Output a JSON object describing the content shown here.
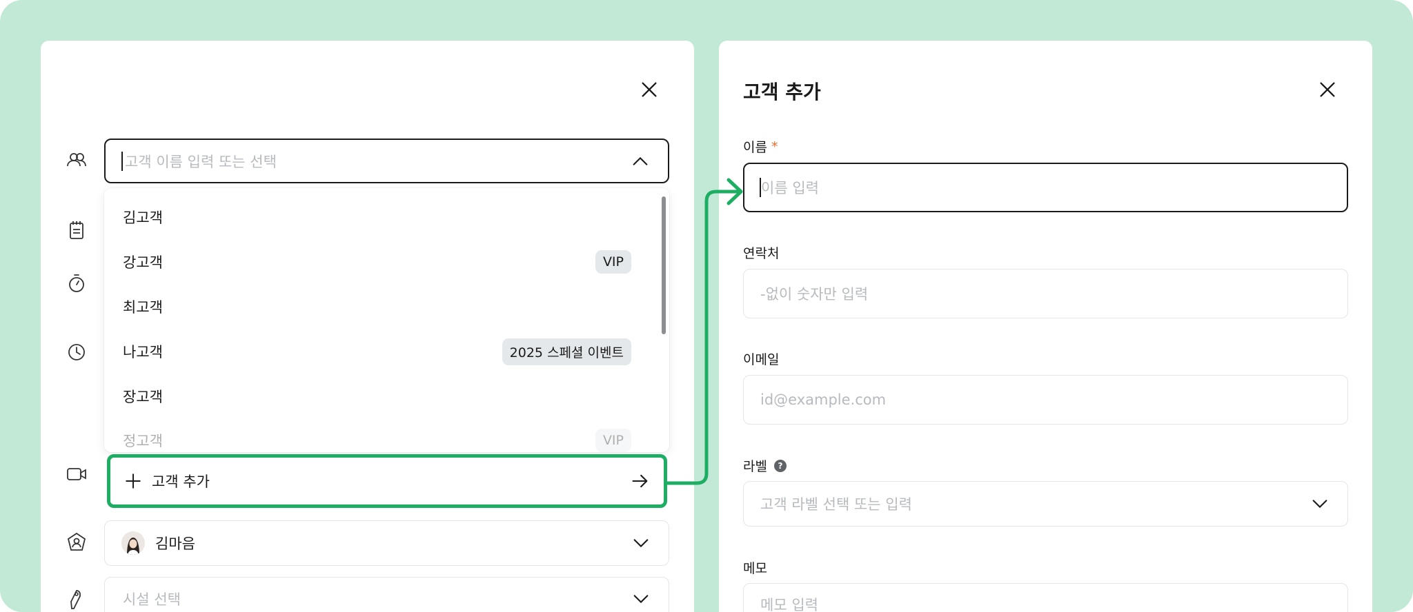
{
  "left_panel": {
    "customer_field": {
      "placeholder": "고객 이름 입력 또는 선택"
    },
    "dropdown": {
      "options": [
        {
          "name": "김고객",
          "tag": ""
        },
        {
          "name": "강고객",
          "tag": "VIP"
        },
        {
          "name": "최고객",
          "tag": ""
        },
        {
          "name": "나고객",
          "tag": "2025 스페셜 이벤트"
        },
        {
          "name": "장고객",
          "tag": ""
        },
        {
          "name": "정고객",
          "tag": "VIP"
        }
      ],
      "add_label": "고객 추가"
    },
    "manager_field": {
      "value": "김마음"
    },
    "facility_field": {
      "placeholder": "시설 선택"
    }
  },
  "right_panel": {
    "title": "고객 추가",
    "name": {
      "label": "이름",
      "required_mark": "*",
      "placeholder": "이름 입력"
    },
    "contact": {
      "label": "연락처",
      "placeholder": "-없이 숫자만 입력"
    },
    "email": {
      "label": "이메일",
      "placeholder": "id@example.com"
    },
    "tag_label": {
      "label": "라벨",
      "help": "?",
      "placeholder": "고객 라벨 선택 또는 입력"
    },
    "memo": {
      "label": "메모",
      "placeholder": "메모 입력"
    }
  },
  "colors": {
    "background": "#c2e9d6",
    "accent_green": "#1dae64",
    "required": "#e86b2c",
    "tag_bg": "#e4e8ea"
  },
  "icons": [
    "users-icon",
    "notepad-icon",
    "stopwatch-icon",
    "clock-icon",
    "video-icon",
    "manager-badge-icon",
    "key-tag-icon",
    "close-icon",
    "chevron-up-icon",
    "chevron-down-icon",
    "plus-icon",
    "arrow-right-icon",
    "help-icon"
  ]
}
